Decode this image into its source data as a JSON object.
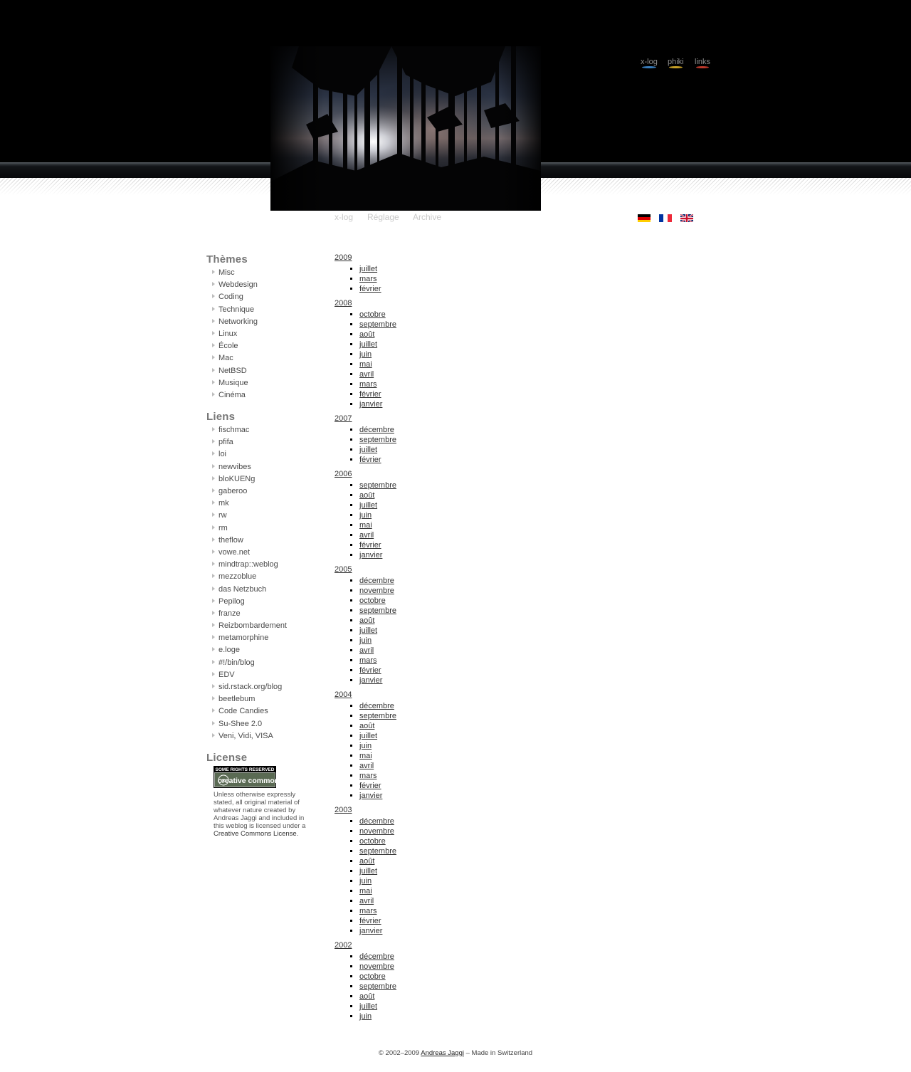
{
  "header": {
    "photo_alt": "",
    "top_nav": [
      {
        "label": "x-log",
        "color": "#3a7fbf"
      },
      {
        "label": "phiki",
        "color": "#c9a227"
      },
      {
        "label": "links",
        "color": "#c0392b"
      }
    ],
    "sub_nav": [
      "x-log",
      "Réglage",
      "Archive"
    ],
    "languages": [
      "de-flag-icon",
      "fr-flag-icon",
      "gb-flag-icon"
    ]
  },
  "sidebar": {
    "themes_title": "Thèmes",
    "themes": [
      "Misc",
      "Webdesign",
      "Coding",
      "Technique",
      "Networking",
      "Linux",
      "École",
      "Mac",
      "NetBSD",
      "Musique",
      "Cinéma"
    ],
    "links_title": "Liens",
    "links": [
      "fischmac",
      "pfifa",
      "loi",
      "newvibes",
      "bloKUENg",
      "gaberoo",
      "mk",
      "rw",
      "rm",
      "theflow",
      "vowe.net",
      "mindtrap::weblog",
      "mezzoblue",
      "das Netzbuch",
      "Pepilog",
      "franze",
      "Reizbombardement",
      "metamorphine",
      "e.loge",
      "#!/bin/blog",
      "EDV",
      "sid.rstack.org/blog",
      "beetlebum",
      "Code Candies",
      "Su-Shee 2.0",
      "Veni, Vidi, VISA"
    ],
    "license_title": "License",
    "license_badge_top": "SOME RIGHTS RESERVED",
    "license_badge_main": "creative commons",
    "license_text": "Unless otherwise expressly stated, all original material of whatever nature created by Andreas Jaggi and included in this weblog is licensed under a ",
    "license_link": "Creative Commons License",
    "license_end": "."
  },
  "archive": [
    {
      "year": "2009",
      "months": [
        "juillet",
        "mars",
        "février"
      ]
    },
    {
      "year": "2008",
      "months": [
        "octobre",
        "septembre",
        "août",
        "juillet",
        "juin",
        "mai",
        "avril",
        "mars",
        "février",
        "janvier"
      ]
    },
    {
      "year": "2007",
      "months": [
        "décembre",
        "septembre",
        "juillet",
        "février"
      ]
    },
    {
      "year": "2006",
      "months": [
        "septembre",
        "août",
        "juillet",
        "juin",
        "mai",
        "avril",
        "février",
        "janvier"
      ]
    },
    {
      "year": "2005",
      "months": [
        "décembre",
        "novembre",
        "octobre",
        "septembre",
        "août",
        "juillet",
        "juin",
        "avril",
        "mars",
        "février",
        "janvier"
      ]
    },
    {
      "year": "2004",
      "months": [
        "décembre",
        "septembre",
        "août",
        "juillet",
        "juin",
        "mai",
        "avril",
        "mars",
        "février",
        "janvier"
      ]
    },
    {
      "year": "2003",
      "months": [
        "décembre",
        "novembre",
        "octobre",
        "septembre",
        "août",
        "juillet",
        "juin",
        "mai",
        "avril",
        "mars",
        "février",
        "janvier"
      ]
    },
    {
      "year": "2002",
      "months": [
        "décembre",
        "novembre",
        "octobre",
        "septembre",
        "août",
        "juillet",
        "juin"
      ]
    }
  ],
  "footer": {
    "prefix": "© 2002–2009 ",
    "author": "Andreas Jaggi",
    "suffix": " – Made in Switzerland"
  }
}
